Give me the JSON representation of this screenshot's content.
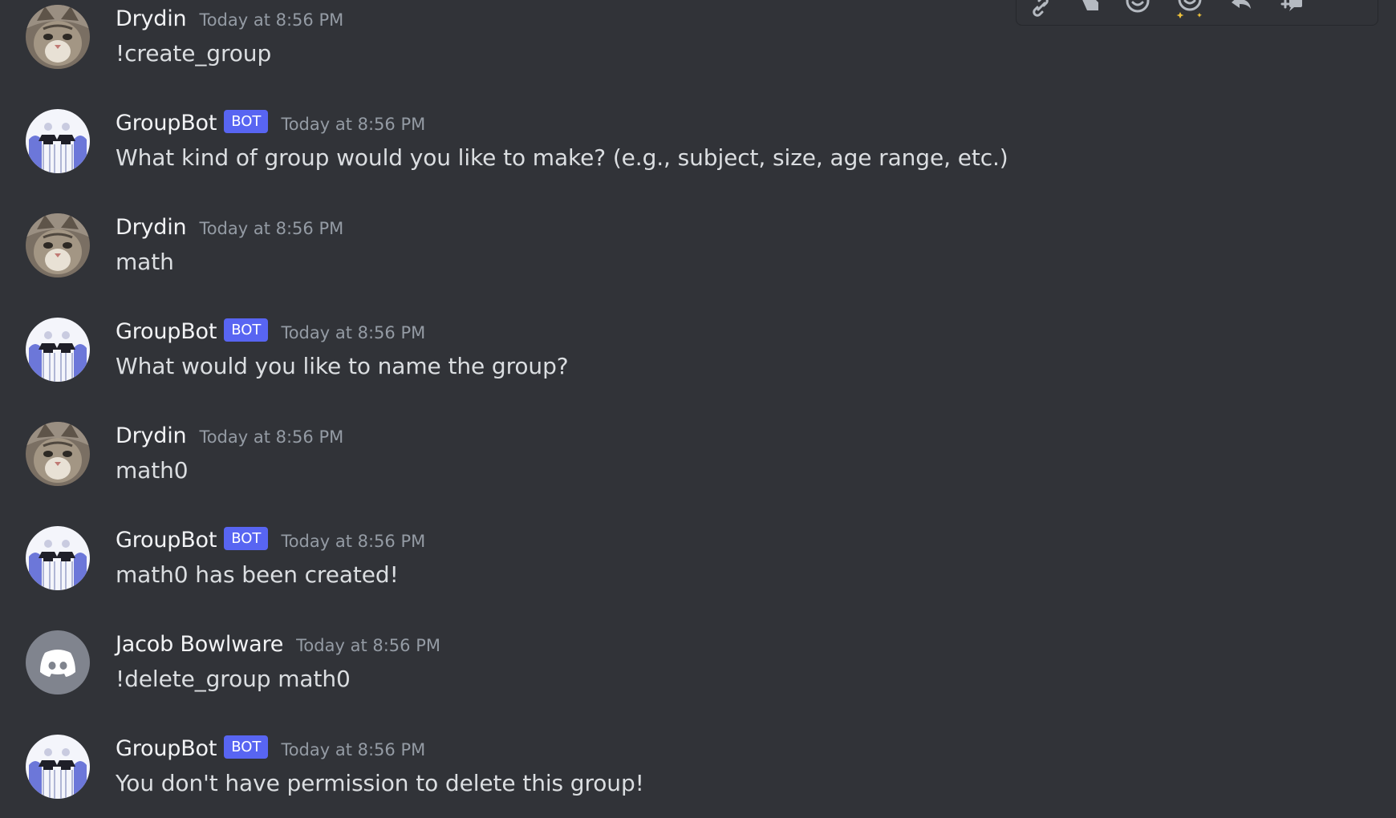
{
  "messages": [
    {
      "author": "Drydin",
      "timestamp": "Today at 8:56 PM",
      "content": "!create_group",
      "avatar": "cat-avatar",
      "bot": false
    },
    {
      "author": "GroupBot",
      "badge": "BOT",
      "timestamp": "Today at 8:56 PM",
      "content": "What kind of group would you like to make? (e.g., subject, size, age range, etc.)",
      "avatar": "group-avatar",
      "bot": true
    },
    {
      "author": "Drydin",
      "timestamp": "Today at 8:56 PM",
      "content": "math",
      "avatar": "cat-avatar",
      "bot": false
    },
    {
      "author": "GroupBot",
      "badge": "BOT",
      "timestamp": "Today at 8:56 PM",
      "content": "What would you like to name the group?",
      "avatar": "group-avatar",
      "bot": true
    },
    {
      "author": "Drydin",
      "timestamp": "Today at 8:56 PM",
      "content": "math0",
      "avatar": "cat-avatar",
      "bot": false
    },
    {
      "author": "GroupBot",
      "badge": "BOT",
      "timestamp": "Today at 8:56 PM",
      "content": "math0 has been created!",
      "avatar": "group-avatar",
      "bot": true
    },
    {
      "author": "Jacob Bowlware",
      "timestamp": "Today at 8:56 PM",
      "content": "!delete_group math0",
      "avatar": "discord-default-avatar",
      "bot": false
    },
    {
      "author": "GroupBot",
      "badge": "BOT",
      "timestamp": "Today at 8:56 PM",
      "content": "You don't have permission to delete this group!",
      "avatar": "group-avatar",
      "bot": true
    }
  ],
  "toolbar": {
    "icons": [
      "link-icon",
      "tag-icon",
      "add-reaction-icon",
      "super-reaction-icon",
      "reply-icon",
      "create-thread-icon",
      "more-icon"
    ]
  },
  "colors": {
    "background": "#313338",
    "author": "#f2f3f5",
    "text": "#dbdee1",
    "timestamp": "#949ba4",
    "bot_badge": "#5865f2",
    "default_avatar": "#80848e"
  }
}
